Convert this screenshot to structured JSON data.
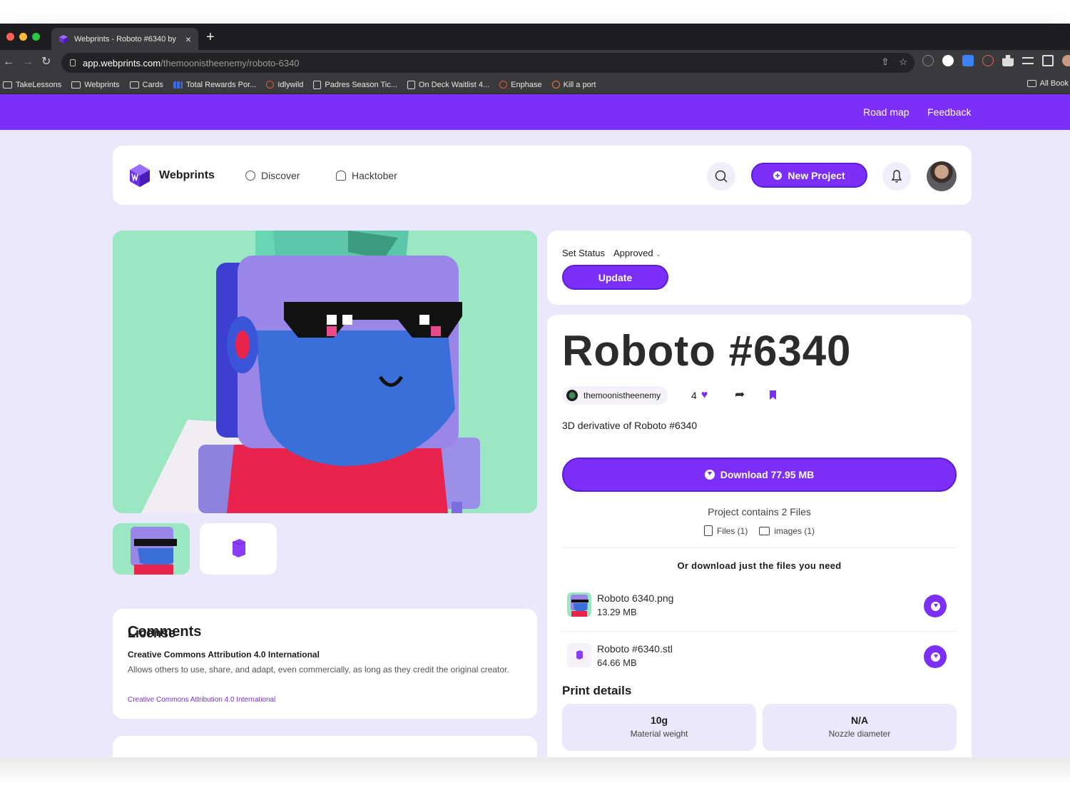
{
  "browser": {
    "tab_title": "Webprints - Roboto #6340 by",
    "url_host": "app.webprints.com",
    "url_path": "/themoonistheenemy/roboto-6340",
    "bookmarks": [
      "TakeLessons",
      "Webprints",
      "Cards",
      "Total Rewards Por...",
      "Idlywild",
      "Padres Season Tic...",
      "On Deck Waitlist 4...",
      "Enphase",
      "Kill a port"
    ],
    "all_bookmarks": "All Book"
  },
  "banner": {
    "roadmap": "Road map",
    "feedback": "Feedback"
  },
  "header": {
    "brand": "Webprints",
    "nav": [
      "Discover",
      "Hacktober"
    ],
    "new_project": "New Project"
  },
  "license": {
    "title": "License",
    "name": "Creative Commons Attribution 4.0 International",
    "description": "Allows others to use, share, and adapt, even commercially, as long as they credit the original creator.",
    "link": "Creative Commons Attribution 4.0 International"
  },
  "comments": {
    "title": "Comments"
  },
  "status": {
    "label": "Set Status",
    "value": "Approved",
    "update": "Update"
  },
  "project": {
    "title": "Roboto #6340",
    "author": "themoonistheenemy",
    "likes": "4",
    "description": "3D derivative of Roboto #6340",
    "download": "Download 77.95 MB",
    "contains": "Project contains 2 Files",
    "files_count": "Files (1)",
    "images_count": "images (1)",
    "or_download": "Or download just the files you need",
    "files": [
      {
        "name": "Roboto 6340.png",
        "size": "13.29 MB"
      },
      {
        "name": "Roboto #6340.stl",
        "size": "64.66 MB"
      }
    ]
  },
  "print_details": {
    "title": "Print details",
    "stats": [
      {
        "value": "10g",
        "label": "Material weight"
      },
      {
        "value": "N/A",
        "label": "Nozzle diameter"
      }
    ]
  },
  "colors": {
    "accent": "#7b2ff7",
    "page_bg": "#ece8fb",
    "hero_bg": "#9be7c4"
  }
}
